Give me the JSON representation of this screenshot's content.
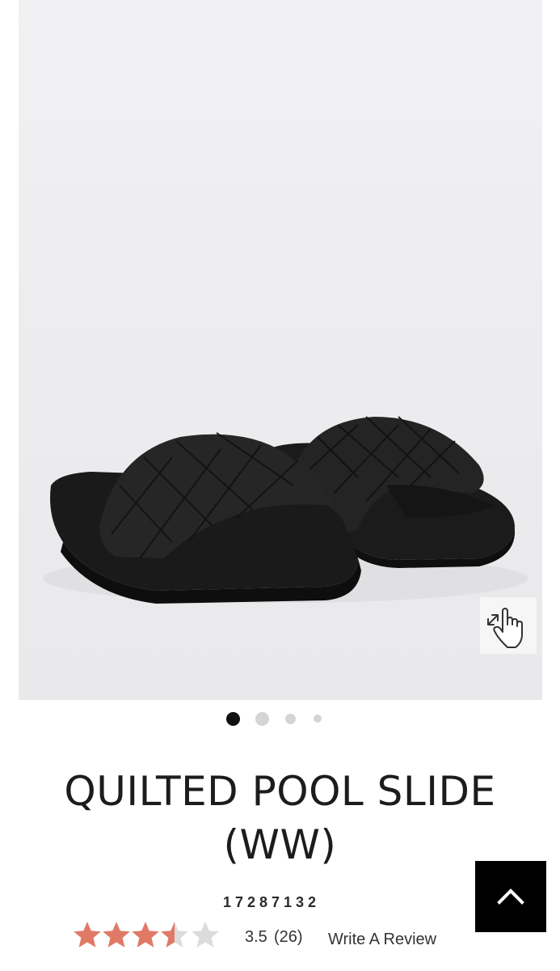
{
  "product": {
    "title_line1": "QUILTED POOL SLIDE",
    "title_line2": "(WW)",
    "sku": "17287132",
    "rating_value": "3.5",
    "rating_count": "(26)",
    "rating_stars": 3.5,
    "rating_max": 5,
    "write_review_label": "Write A Review"
  },
  "gallery": {
    "image_count": 4,
    "active_index": 0,
    "zoom_icon": "zoom-hand-icon"
  },
  "icons": {
    "back_to_top": "chevron-up-icon",
    "star": "star-icon"
  },
  "colors": {
    "star_filled": "#e07a67",
    "star_empty": "#dcdcdc",
    "active_dot": "#111111",
    "inactive_dot": "#d5d5d8",
    "back_to_top_bg": "#000000"
  }
}
